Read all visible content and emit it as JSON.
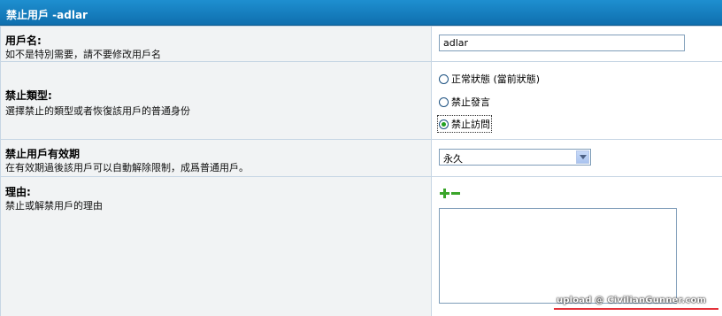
{
  "header": {
    "title": "禁止用戶 -adlar"
  },
  "username": {
    "label": "用戶名:",
    "desc": "如不是特別需要，請不要修改用戶名",
    "value": "adlar"
  },
  "ban_type": {
    "label": "禁止類型:",
    "desc": "選擇禁止的類型或者恢復該用戶的普通身份",
    "options": [
      "正常狀態 (當前狀態)",
      "禁止發言",
      "禁止訪問"
    ],
    "selected": "禁止訪問"
  },
  "expiry": {
    "label": "禁止用戶有效期",
    "desc": "在有效期過後該用戶可以自動解除限制，成爲普通用戶。",
    "value": "永久"
  },
  "reason": {
    "label": "理由:",
    "desc": "禁止或解禁用戶的理由",
    "text": ""
  },
  "watermark": "upload @ CivilianGunner.com",
  "colors": {
    "header": "#1477ba",
    "left_bg": "#f1f3f4",
    "border": "#c7d6e4",
    "icon_green": "#3aa52a"
  }
}
